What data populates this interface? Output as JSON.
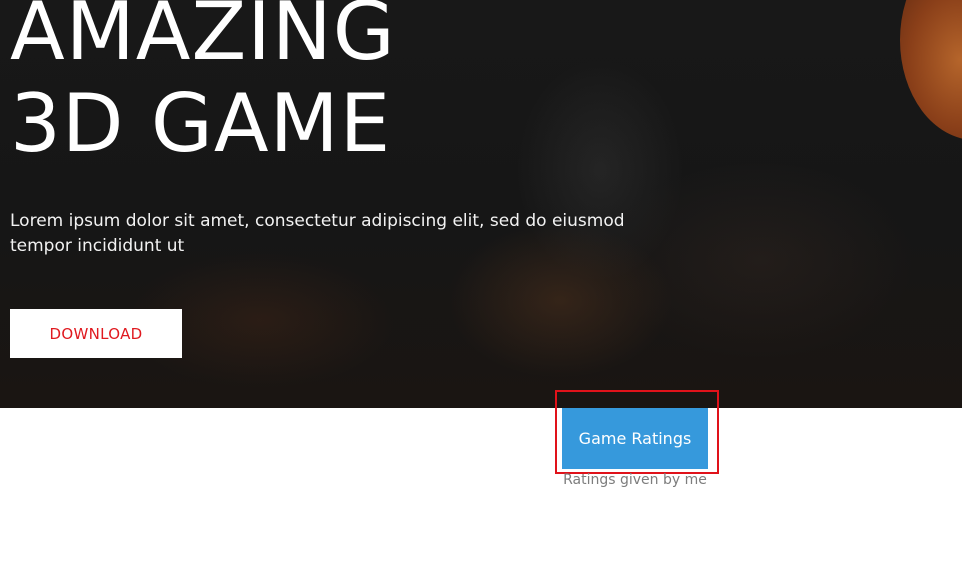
{
  "hero": {
    "title_line1": "AMAZING",
    "title_line2": "3D GAME",
    "description": "Lorem ipsum dolor sit amet, consectetur adipiscing elit, sed do eiusmod tempor incididunt ut",
    "download_label": "DOWNLOAD"
  },
  "ratings": {
    "button_label": "Game Ratings",
    "caption": "Ratings given by me"
  },
  "colors": {
    "hero_background": "#161616",
    "download_text": "#e0191f",
    "ratings_button": "#3699dc",
    "highlight_border": "#e0121a",
    "caption_text": "#7d7d7d"
  }
}
